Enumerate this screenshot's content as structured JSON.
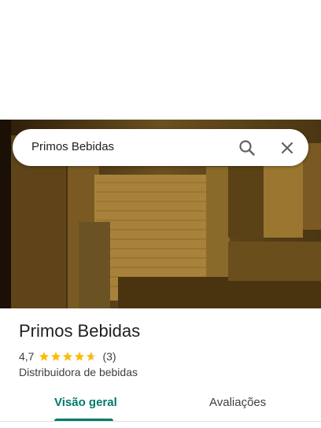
{
  "search": {
    "query": "Primos Bebidas",
    "icons": [
      "search-icon",
      "close-icon"
    ]
  },
  "place": {
    "name": "Primos Bebidas",
    "rating": "4,7",
    "rating_value": 4.7,
    "review_count": "(3)",
    "category": "Distribuidora de bebidas"
  },
  "tabs": [
    {
      "label": "Visão geral",
      "active": true
    },
    {
      "label": "Avaliações",
      "active": false
    }
  ],
  "colors": {
    "accent": "#00796b",
    "star": "#fbbc04",
    "text": "#202124"
  }
}
